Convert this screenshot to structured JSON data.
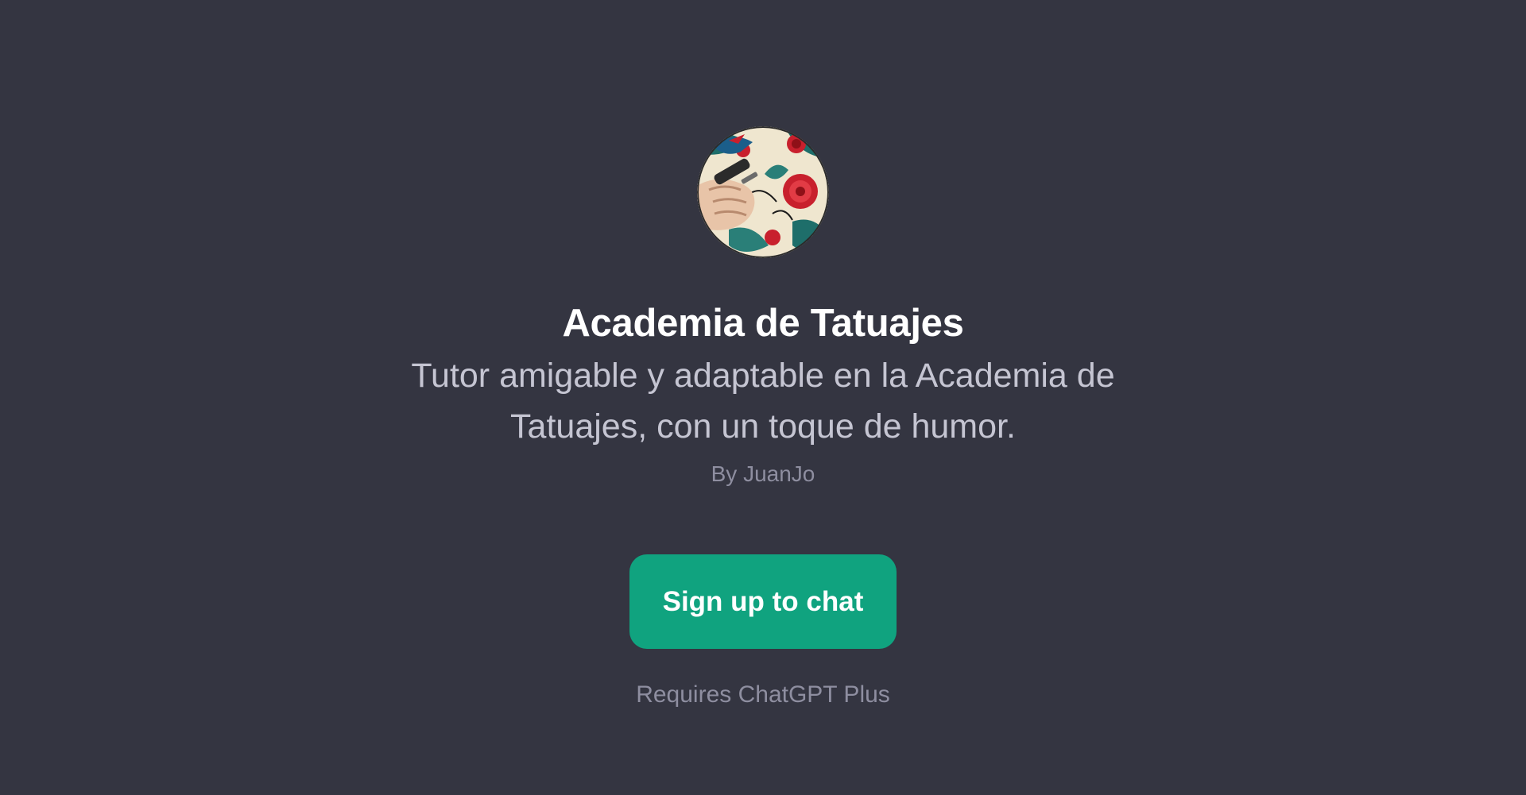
{
  "gpt": {
    "name": "Academia de Tatuajes",
    "description": "Tutor amigable y adaptable en la Academia de Tatuajes, con un toque de humor.",
    "author": "By JuanJo",
    "avatar_icon": "tattoo-artist-hand-avatar"
  },
  "actions": {
    "signup_label": "Sign up to chat",
    "requirement_note": "Requires ChatGPT Plus"
  },
  "colors": {
    "background": "#343541",
    "accent": "#10a37f",
    "title": "#ffffff",
    "description": "#c5c5d2",
    "muted": "#8e8ea0"
  }
}
